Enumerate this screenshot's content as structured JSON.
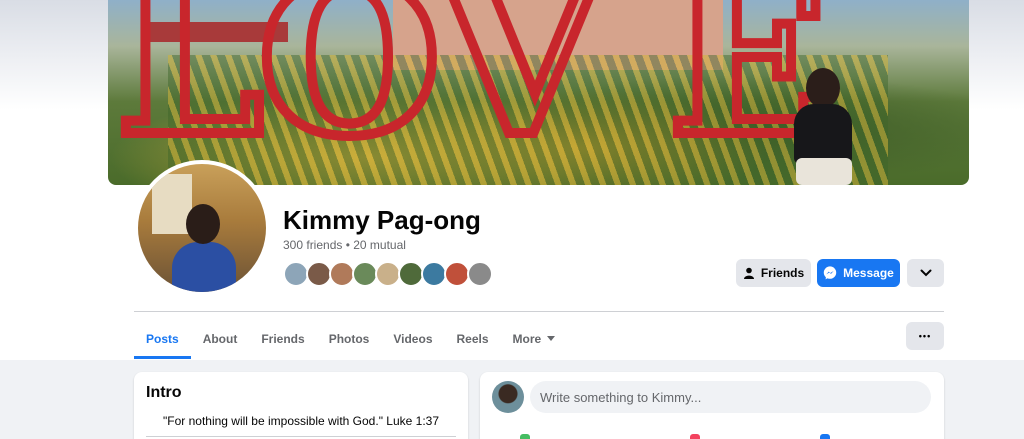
{
  "cover": {
    "letters": [
      "L",
      "O",
      "V",
      "E"
    ]
  },
  "profile": {
    "name": "Kimmy Pag-ong",
    "friends_summary": "300 friends • 20 mutual",
    "mutual_friend_colors": [
      "#8da5b8",
      "#7a5a48",
      "#b07a5a",
      "#6a8a5a",
      "#c9b08a",
      "#4f6a3a",
      "#3c7aa0",
      "#c0503a",
      "#8a8a8a"
    ]
  },
  "actions": {
    "friends_label": "Friends",
    "message_label": "Message",
    "more_icon": "chevron-down-icon",
    "dots_label": "•••"
  },
  "tabs": [
    {
      "label": "Posts",
      "active": true
    },
    {
      "label": "About",
      "active": false
    },
    {
      "label": "Friends",
      "active": false
    },
    {
      "label": "Photos",
      "active": false
    },
    {
      "label": "Videos",
      "active": false
    },
    {
      "label": "Reels",
      "active": false
    },
    {
      "label": "More",
      "active": false
    }
  ],
  "intro": {
    "title": "Intro",
    "bio": "\"For nothing will be impossible with God.\" Luke 1:37"
  },
  "composer": {
    "placeholder": "Write something to Kimmy..."
  },
  "colors": {
    "accent": "#1877f2",
    "button_gray": "#e4e6eb",
    "page_bg": "#f0f2f5",
    "secondary_text": "#65676b"
  }
}
